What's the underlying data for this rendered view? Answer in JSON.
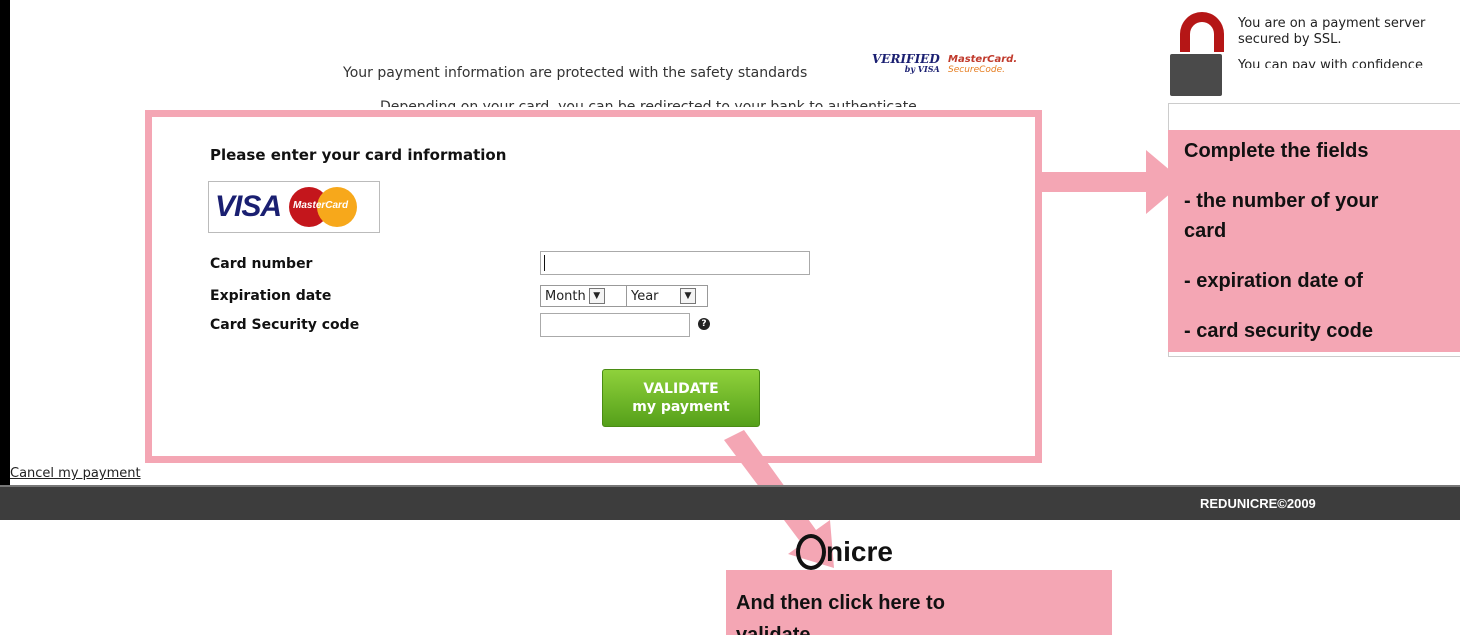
{
  "security": {
    "protected_text": "Your payment information are protected with the safety standards",
    "verified_top": "VERIFIED",
    "verified_bottom": "by VISA",
    "mastercard_top": "MasterCard.",
    "mastercard_bottom": "SecureCode.",
    "redirect_text": "Depending on your card, you can be redirected to your bank to authenticate"
  },
  "ssl": {
    "line1": "You are on a payment server",
    "line2": "secured by SSL.",
    "line3": "You can pay with confidence"
  },
  "form": {
    "title": "Please enter your card information",
    "visa_logo": "VISA",
    "mastercard_logo": "MasterCard",
    "card_number_label": "Card number",
    "card_number_value": "",
    "expiration_label": "Expiration date",
    "month_selected": "Month",
    "year_selected": "Year",
    "security_code_label": "Card Security code",
    "security_code_value": "",
    "help_icon": "question-icon",
    "validate_line1": "VALIDATE",
    "validate_line2": "my payment"
  },
  "callout_right": {
    "heading": "Complete the fields",
    "item1": "- the number of your",
    "item1b": "card",
    "item2": "- expiration date of",
    "item3": "- card security code"
  },
  "callout_bottom": {
    "text": "And then click here to",
    "text_cut": "validate"
  },
  "cancel_link": "Cancel my payment",
  "footer": {
    "copyright": "REDUNICRE©2009"
  },
  "brand": {
    "logo_text": "nicre",
    "logo_mark": "U"
  },
  "colors": {
    "annotation_pink": "#f4a6b4",
    "validate_green": "#6cbf21",
    "footer_bg": "#3d3d3d",
    "lock_red": "#b51616"
  }
}
